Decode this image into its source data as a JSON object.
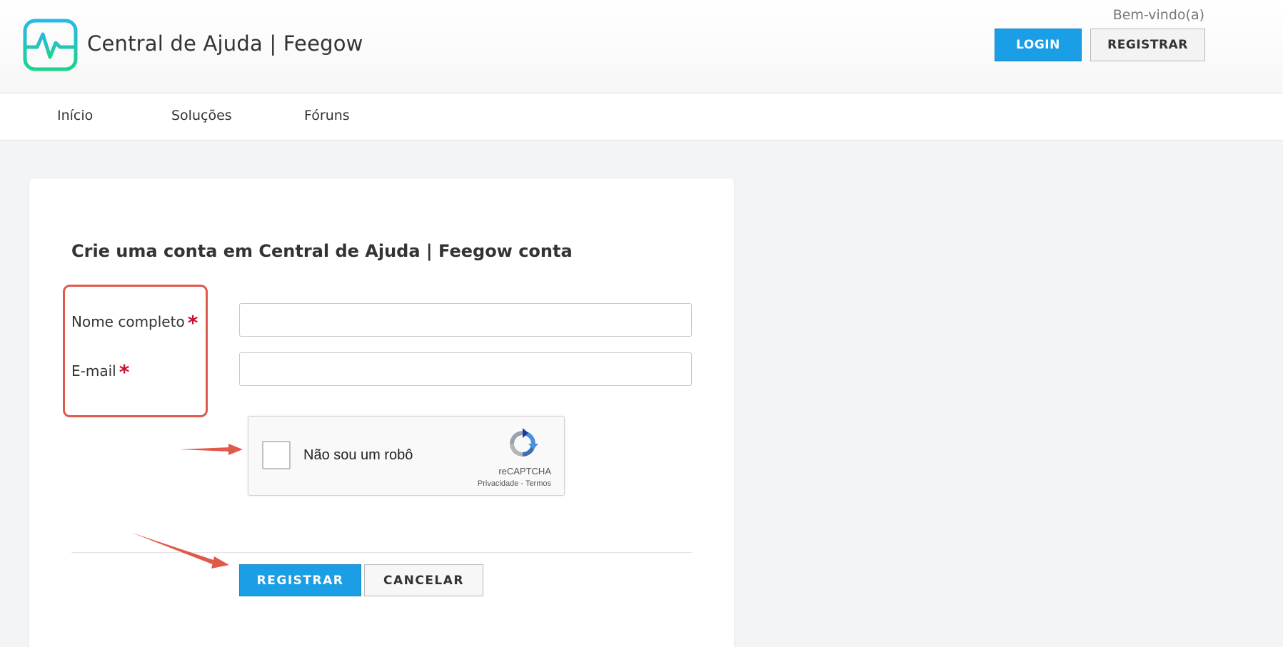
{
  "header": {
    "brand": "Central de Ajuda | Feegow",
    "welcome": "Bem-vindo(a)",
    "login_label": "LOGIN",
    "register_label": "REGISTRAR",
    "logo_icon": "heartbeat-monitor-icon"
  },
  "nav": {
    "items": [
      {
        "label": "Início"
      },
      {
        "label": "Soluções"
      },
      {
        "label": "Fóruns"
      }
    ]
  },
  "form": {
    "title": "Crie uma conta em Central de Ajuda | Feegow conta",
    "fields": [
      {
        "label": "Nome completo",
        "required_mark": "*",
        "value": ""
      },
      {
        "label": "E-mail",
        "required_mark": "*",
        "value": ""
      }
    ],
    "captcha": {
      "label": "Não sou um robô",
      "brand": "reCAPTCHA",
      "links": "Privacidade - Termos",
      "checked": false
    },
    "submit_label": "REGISTRAR",
    "cancel_label": "CANCELAR"
  },
  "colors": {
    "primary": "#1a9fe6",
    "required": "#c8102e",
    "annotation": "#e05a4b",
    "logo_gradient_start": "#22c9d8",
    "logo_gradient_end": "#1bd17f"
  }
}
